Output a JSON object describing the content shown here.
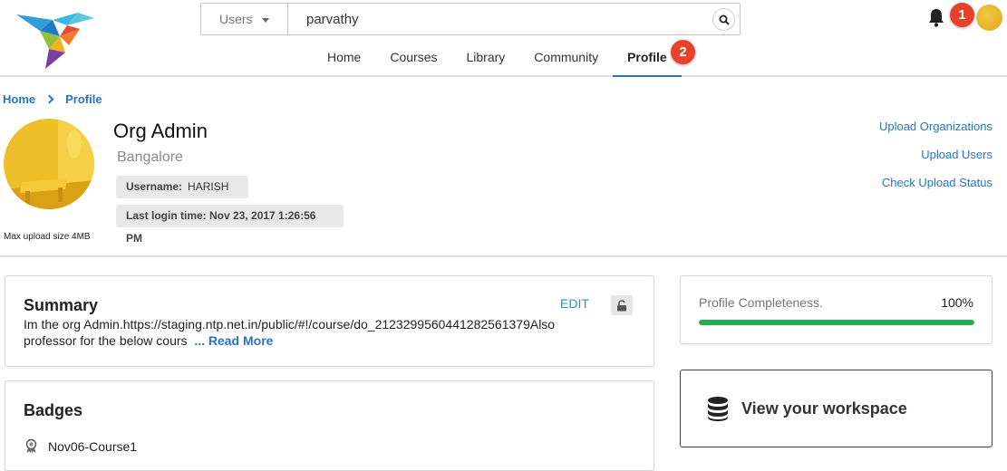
{
  "header": {
    "search_scope": "Users",
    "search_value": "parvathy",
    "nav": [
      "Home",
      "Courses",
      "Library",
      "Community",
      "Profile"
    ],
    "active_nav": "Profile",
    "markers": [
      "1",
      "2"
    ]
  },
  "breadcrumb": [
    "Home",
    "Profile"
  ],
  "profile": {
    "name": "Org Admin",
    "location": "Bangalore",
    "username_label": "Username:",
    "username": "HARISH",
    "last_login": "Last login time: Nov 23, 2017 1:26:56 PM",
    "upload_note": "Max upload size 4MB"
  },
  "admin_links": [
    "Upload Organizations",
    "Upload Users",
    "Check Upload Status"
  ],
  "summary": {
    "title": "Summary",
    "edit_label": "EDIT",
    "text": "Im the org Admin.https://staging.ntp.net.in/public/#!/course/do_2123299560441282561379Also professor for the below cours",
    "read_more": "... Read More"
  },
  "badges": {
    "title": "Badges",
    "items": [
      "Nov06-Course1"
    ]
  },
  "completeness": {
    "label": "Profile Completeness.",
    "value_text": "100%",
    "value": 100
  },
  "workspace": {
    "label": "View your workspace"
  },
  "colors": {
    "link": "#2774c6",
    "progress": "#21b04b",
    "marker": "#e8412a"
  }
}
